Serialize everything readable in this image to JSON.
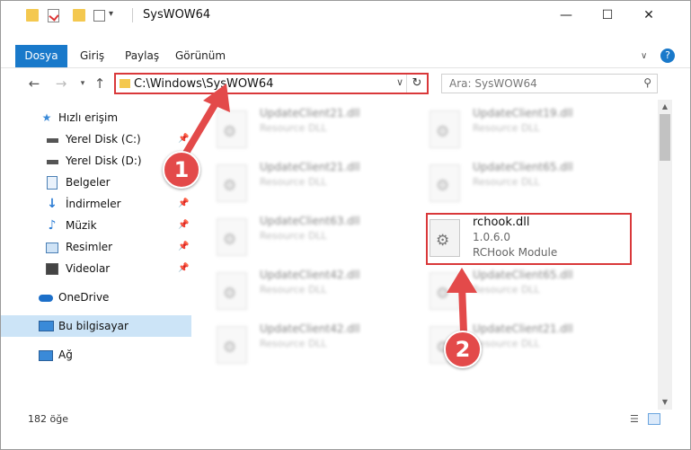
{
  "window": {
    "title": "SysWOW64",
    "controls": {
      "minimize": "—",
      "maximize": "☐",
      "close": "✕"
    }
  },
  "ribbon": {
    "file_tab": "Dosya",
    "tabs": [
      "Giriş",
      "Paylaş",
      "Görünüm"
    ],
    "help": "?"
  },
  "nav": {
    "address": "C:\\Windows\\SysWOW64",
    "search_placeholder": "Ara: SysWOW64"
  },
  "sidebar": {
    "items": [
      {
        "label": "Hızlı erişim",
        "icon": "star-icon"
      },
      {
        "label": "Yerel Disk (C:)",
        "icon": "drive-icon",
        "pinned": true
      },
      {
        "label": "Yerel Disk (D:)",
        "icon": "drive-icon"
      },
      {
        "label": "Belgeler",
        "icon": "document-icon",
        "pinned": true
      },
      {
        "label": "İndirmeler",
        "icon": "download-icon",
        "pinned": true
      },
      {
        "label": "Müzik",
        "icon": "music-icon",
        "pinned": true
      },
      {
        "label": "Resimler",
        "icon": "pictures-icon",
        "pinned": true
      },
      {
        "label": "Videolar",
        "icon": "video-icon",
        "pinned": true
      },
      {
        "label": "OneDrive",
        "icon": "cloud-icon"
      },
      {
        "label": "Bu bilgisayar",
        "icon": "computer-icon",
        "selected": true
      },
      {
        "label": "Ağ",
        "icon": "network-icon"
      }
    ]
  },
  "files": [
    {
      "name": "UpdateClient21.dll",
      "type": "Resource DLL"
    },
    {
      "name": "UpdateClient19.dll",
      "type": "Resource DLL"
    },
    {
      "name": "UpdateClient21.dll",
      "type": "Resource DLL"
    },
    {
      "name": "UpdateClient65.dll",
      "type": "Resource DLL"
    },
    {
      "name": "UpdateClient63.dll",
      "type": "Resource DLL"
    },
    {
      "name": "rchook.dll",
      "version": "1.0.6.0",
      "type": "RCHook Module"
    },
    {
      "name": "UpdateClient42.dll",
      "type": "Resource DLL"
    },
    {
      "name": "UpdateClient65.dll",
      "type": "Resource DLL"
    },
    {
      "name": "UpdateClient42.dll",
      "type": "Resource DLL"
    },
    {
      "name": "UpdateClient21.dll",
      "type": "Resource DLL"
    }
  ],
  "status": {
    "count": "182 öğe"
  },
  "annotations": {
    "step1": "1",
    "step2": "2"
  },
  "colors": {
    "accent": "#1979ca",
    "highlight": "#d9383a",
    "selected": "#cce4f7"
  }
}
